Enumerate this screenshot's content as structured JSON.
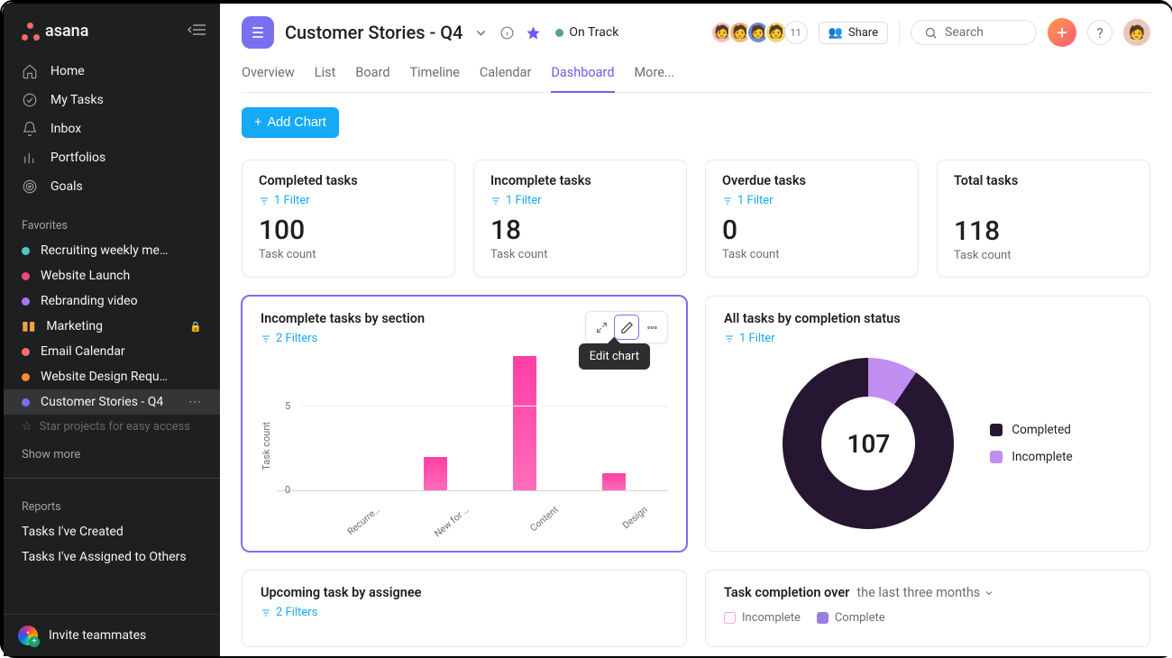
{
  "brand": "asana",
  "sidebar": {
    "nav": [
      {
        "icon": "home",
        "label": "Home"
      },
      {
        "icon": "check",
        "label": "My Tasks"
      },
      {
        "icon": "bell",
        "label": "Inbox"
      },
      {
        "icon": "bars",
        "label": "Portfolios"
      },
      {
        "icon": "target",
        "label": "Goals"
      }
    ],
    "favorites_title": "Favorites",
    "favorites": [
      {
        "color": "#4ecbc4",
        "label": "Recruiting weekly me…"
      },
      {
        "color": "#f1477e",
        "label": "Website Launch"
      },
      {
        "color": "#a876ff",
        "label": "Rebranding video"
      },
      {
        "color": "#f1a33c",
        "label": "Marketing",
        "lock": true,
        "bars": true
      },
      {
        "color": "#ff6e6e",
        "label": "Email Calendar"
      },
      {
        "color": "#ff8d2e",
        "label": "Website Design Requ…"
      },
      {
        "color": "#7a6ff0",
        "label": "Customer Stories - Q4",
        "active": true,
        "more": true
      }
    ],
    "star_hint": "Star projects for easy access",
    "show_more": "Show more",
    "reports_title": "Reports",
    "reports": [
      "Tasks I've Created",
      "Tasks I've Assigned to Others"
    ],
    "invite": "Invite teammates"
  },
  "header": {
    "title": "Customer Stories - Q4",
    "status": "On Track",
    "avatars_extra": "11",
    "share": "Share",
    "search_placeholder": "Search",
    "tabs": [
      "Overview",
      "List",
      "Board",
      "Timeline",
      "Calendar",
      "Dashboard",
      "More..."
    ],
    "active_tab": "Dashboard"
  },
  "content": {
    "add_chart": "Add Chart",
    "stats": [
      {
        "title": "Completed tasks",
        "filter": "1 Filter",
        "value": "100",
        "sub": "Task count"
      },
      {
        "title": "Incomplete tasks",
        "filter": "1 Filter",
        "value": "18",
        "sub": "Task count"
      },
      {
        "title": "Overdue tasks",
        "filter": "1 Filter",
        "value": "0",
        "sub": "Task count"
      },
      {
        "title": "Total tasks",
        "value": "118",
        "sub": "Task count"
      }
    ],
    "panel_bar": {
      "title": "Incomplete tasks by section",
      "filter": "2 Filters",
      "tooltip": "Edit chart",
      "ylabel": "Task count"
    },
    "panel_donut": {
      "title": "All tasks by completion status",
      "filter": "1 Filter",
      "center": "107",
      "legend": [
        {
          "color": "#271631",
          "label": "Completed"
        },
        {
          "color": "#c08ef0",
          "label": "Incomplete"
        }
      ]
    },
    "panel_upcoming": {
      "title": "Upcoming task by assignee",
      "filter": "2 Filters"
    },
    "panel_completion": {
      "title": "Task completion over",
      "range": "the last three months",
      "legend": [
        {
          "border": "#f0a8d4",
          "fill": "transparent",
          "label": "Incomplete"
        },
        {
          "border": "#9b7de0",
          "fill": "#9b7de0",
          "label": "Complete"
        }
      ]
    }
  },
  "chart_data": [
    {
      "id": "incomplete_by_section",
      "type": "bar",
      "title": "Incomplete tasks by section",
      "ylabel": "Task count",
      "ylim": [
        0,
        8
      ],
      "yticks": [
        0,
        5
      ],
      "categories": [
        "Recurre…",
        "New for …",
        "Content",
        "Design"
      ],
      "values": [
        0,
        2,
        8,
        1
      ]
    },
    {
      "id": "completion_status",
      "type": "pie",
      "title": "All tasks by completion status",
      "center_label": "107",
      "series": [
        {
          "name": "Completed",
          "value": 97,
          "color": "#271631"
        },
        {
          "name": "Incomplete",
          "value": 10,
          "color": "#c08ef0"
        }
      ]
    }
  ]
}
